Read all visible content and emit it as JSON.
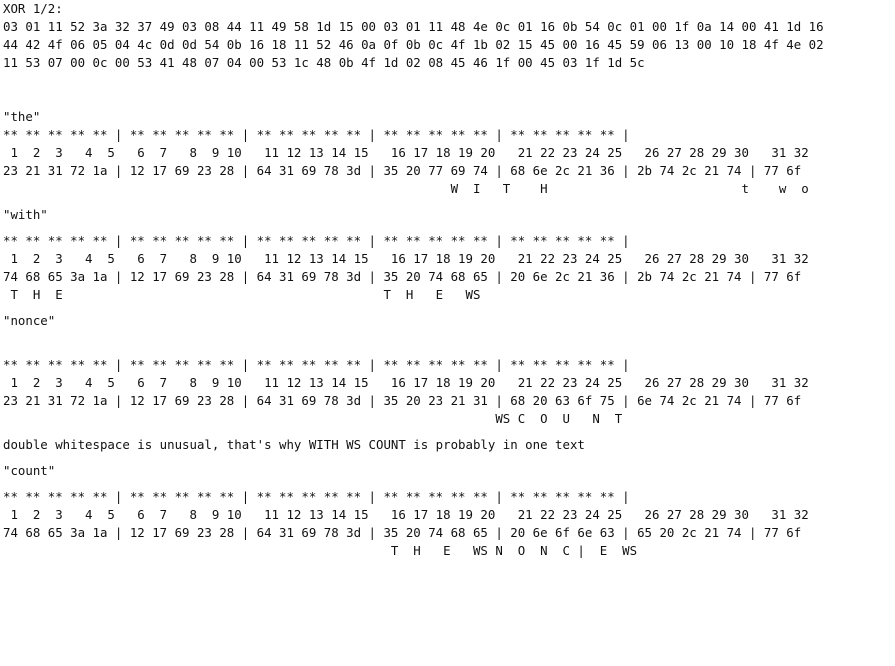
{
  "header": {
    "title": "XOR 1/2:",
    "hex_lines": [
      "03 01 11 52 3a 32 37 49 03 08 44 11 49 58 1d 15 00 03 01 11 48 4e 0c 01 16 0b 54 0c 01 00 1f 0a 14 00 41 1d 16",
      "44 42 4f 06 05 04 4c 0d 0d 54 0b 16 18 11 52 46 0a 0f 0b 0c 4f 1b 02 15 45 00 16 45 59 06 13 00 10 18 4f 4e 02",
      "11 53 07 00 0c 00 53 41 48 07 04 00 53 1c 48 0b 4f 1d 02 08 45 46 1f 00 45 03 1f 1d 5c"
    ]
  },
  "sections": [
    {
      "label": "\"the\"",
      "stars": "** ** ** ** ** | ** ** ** ** ** | ** ** ** ** ** | ** ** ** ** ** | ** ** ** ** ** |",
      "numbers": " 1  2  3   4  5   6  7   8  9 10   11 12 13 14 15   16 17 18 19 20   21 22 23 24 25   26 27 28 29 30   31 32",
      "hex": "23 21 31 72 1a | 12 17 69 23 28 | 64 31 69 78 3d | 35 20 77 69 74 | 68 6e 2c 21 36 | 2b 74 2c 21 74 | 77 6f",
      "decoded": "                                                            W  I   T    H                          t    w  o"
    },
    {
      "label": "\"with\"",
      "stars": "** ** ** ** ** | ** ** ** ** ** | ** ** ** ** ** | ** ** ** ** ** | ** ** ** ** ** |",
      "numbers": " 1  2  3   4  5   6  7   8  9 10   11 12 13 14 15   16 17 18 19 20   21 22 23 24 25   26 27 28 29 30   31 32",
      "hex": "74 68 65 3a 1a | 12 17 69 23 28 | 64 31 69 78 3d | 35 20 74 68 65 | 20 6e 2c 21 36 | 2b 74 2c 21 74 | 77 6f",
      "decoded": " T  H  E                                           T  H   E   WS"
    },
    {
      "label": "\"nonce\"",
      "stars": "** ** ** ** ** | ** ** ** ** ** | ** ** ** ** ** | ** ** ** ** ** | ** ** ** ** ** |",
      "numbers": " 1  2  3   4  5   6  7   8  9 10   11 12 13 14 15   16 17 18 19 20   21 22 23 24 25   26 27 28 29 30   31 32",
      "hex": "23 21 31 72 1a | 12 17 69 23 28 | 64 31 69 78 3d | 35 20 23 21 31 | 68 20 63 6f 75 | 6e 74 2c 21 74 | 77 6f",
      "decoded": "                                                                  WS C  O  U   N  T"
    },
    {
      "label": "\"count\"",
      "stars": "** ** ** ** ** | ** ** ** ** ** | ** ** ** ** ** | ** ** ** ** ** | ** ** ** ** ** |",
      "numbers": " 1  2  3   4  5   6  7   8  9 10   11 12 13 14 15   16 17 18 19 20   21 22 23 24 25   26 27 28 29 30   31 32",
      "hex": "74 68 65 3a 1a | 12 17 69 23 28 | 64 31 69 78 3d | 35 20 74 68 65 | 20 6e 6f 6e 63 | 65 20 2c 21 74 | 77 6f",
      "decoded": "                                                    T  H   E   WS N  O  N  C |  E  WS"
    }
  ],
  "note": "double whitespace is unusual, that's why WITH WS COUNT is probably in one text"
}
